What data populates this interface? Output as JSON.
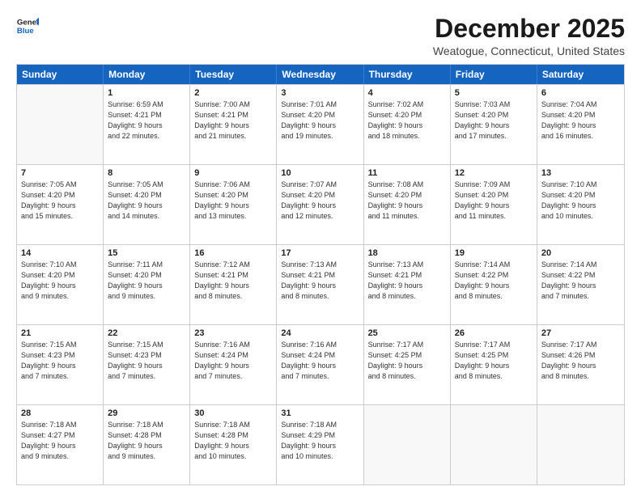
{
  "logo": {
    "line1": "General",
    "line2": "Blue"
  },
  "title": "December 2025",
  "subtitle": "Weatogue, Connecticut, United States",
  "header": {
    "days": [
      "Sunday",
      "Monday",
      "Tuesday",
      "Wednesday",
      "Thursday",
      "Friday",
      "Saturday"
    ]
  },
  "weeks": [
    {
      "cells": [
        {
          "empty": true
        },
        {
          "day": "1",
          "info": "Sunrise: 6:59 AM\nSunset: 4:21 PM\nDaylight: 9 hours\nand 22 minutes."
        },
        {
          "day": "2",
          "info": "Sunrise: 7:00 AM\nSunset: 4:21 PM\nDaylight: 9 hours\nand 21 minutes."
        },
        {
          "day": "3",
          "info": "Sunrise: 7:01 AM\nSunset: 4:20 PM\nDaylight: 9 hours\nand 19 minutes."
        },
        {
          "day": "4",
          "info": "Sunrise: 7:02 AM\nSunset: 4:20 PM\nDaylight: 9 hours\nand 18 minutes."
        },
        {
          "day": "5",
          "info": "Sunrise: 7:03 AM\nSunset: 4:20 PM\nDaylight: 9 hours\nand 17 minutes."
        },
        {
          "day": "6",
          "info": "Sunrise: 7:04 AM\nSunset: 4:20 PM\nDaylight: 9 hours\nand 16 minutes."
        }
      ]
    },
    {
      "cells": [
        {
          "day": "7",
          "info": "Sunrise: 7:05 AM\nSunset: 4:20 PM\nDaylight: 9 hours\nand 15 minutes."
        },
        {
          "day": "8",
          "info": "Sunrise: 7:05 AM\nSunset: 4:20 PM\nDaylight: 9 hours\nand 14 minutes."
        },
        {
          "day": "9",
          "info": "Sunrise: 7:06 AM\nSunset: 4:20 PM\nDaylight: 9 hours\nand 13 minutes."
        },
        {
          "day": "10",
          "info": "Sunrise: 7:07 AM\nSunset: 4:20 PM\nDaylight: 9 hours\nand 12 minutes."
        },
        {
          "day": "11",
          "info": "Sunrise: 7:08 AM\nSunset: 4:20 PM\nDaylight: 9 hours\nand 11 minutes."
        },
        {
          "day": "12",
          "info": "Sunrise: 7:09 AM\nSunset: 4:20 PM\nDaylight: 9 hours\nand 11 minutes."
        },
        {
          "day": "13",
          "info": "Sunrise: 7:10 AM\nSunset: 4:20 PM\nDaylight: 9 hours\nand 10 minutes."
        }
      ]
    },
    {
      "cells": [
        {
          "day": "14",
          "info": "Sunrise: 7:10 AM\nSunset: 4:20 PM\nDaylight: 9 hours\nand 9 minutes."
        },
        {
          "day": "15",
          "info": "Sunrise: 7:11 AM\nSunset: 4:20 PM\nDaylight: 9 hours\nand 9 minutes."
        },
        {
          "day": "16",
          "info": "Sunrise: 7:12 AM\nSunset: 4:21 PM\nDaylight: 9 hours\nand 8 minutes."
        },
        {
          "day": "17",
          "info": "Sunrise: 7:13 AM\nSunset: 4:21 PM\nDaylight: 9 hours\nand 8 minutes."
        },
        {
          "day": "18",
          "info": "Sunrise: 7:13 AM\nSunset: 4:21 PM\nDaylight: 9 hours\nand 8 minutes."
        },
        {
          "day": "19",
          "info": "Sunrise: 7:14 AM\nSunset: 4:22 PM\nDaylight: 9 hours\nand 8 minutes."
        },
        {
          "day": "20",
          "info": "Sunrise: 7:14 AM\nSunset: 4:22 PM\nDaylight: 9 hours\nand 7 minutes."
        }
      ]
    },
    {
      "cells": [
        {
          "day": "21",
          "info": "Sunrise: 7:15 AM\nSunset: 4:23 PM\nDaylight: 9 hours\nand 7 minutes."
        },
        {
          "day": "22",
          "info": "Sunrise: 7:15 AM\nSunset: 4:23 PM\nDaylight: 9 hours\nand 7 minutes."
        },
        {
          "day": "23",
          "info": "Sunrise: 7:16 AM\nSunset: 4:24 PM\nDaylight: 9 hours\nand 7 minutes."
        },
        {
          "day": "24",
          "info": "Sunrise: 7:16 AM\nSunset: 4:24 PM\nDaylight: 9 hours\nand 7 minutes."
        },
        {
          "day": "25",
          "info": "Sunrise: 7:17 AM\nSunset: 4:25 PM\nDaylight: 9 hours\nand 8 minutes."
        },
        {
          "day": "26",
          "info": "Sunrise: 7:17 AM\nSunset: 4:25 PM\nDaylight: 9 hours\nand 8 minutes."
        },
        {
          "day": "27",
          "info": "Sunrise: 7:17 AM\nSunset: 4:26 PM\nDaylight: 9 hours\nand 8 minutes."
        }
      ]
    },
    {
      "cells": [
        {
          "day": "28",
          "info": "Sunrise: 7:18 AM\nSunset: 4:27 PM\nDaylight: 9 hours\nand 9 minutes."
        },
        {
          "day": "29",
          "info": "Sunrise: 7:18 AM\nSunset: 4:28 PM\nDaylight: 9 hours\nand 9 minutes."
        },
        {
          "day": "30",
          "info": "Sunrise: 7:18 AM\nSunset: 4:28 PM\nDaylight: 9 hours\nand 10 minutes."
        },
        {
          "day": "31",
          "info": "Sunrise: 7:18 AM\nSunset: 4:29 PM\nDaylight: 9 hours\nand 10 minutes."
        },
        {
          "empty": true
        },
        {
          "empty": true
        },
        {
          "empty": true
        }
      ]
    }
  ]
}
